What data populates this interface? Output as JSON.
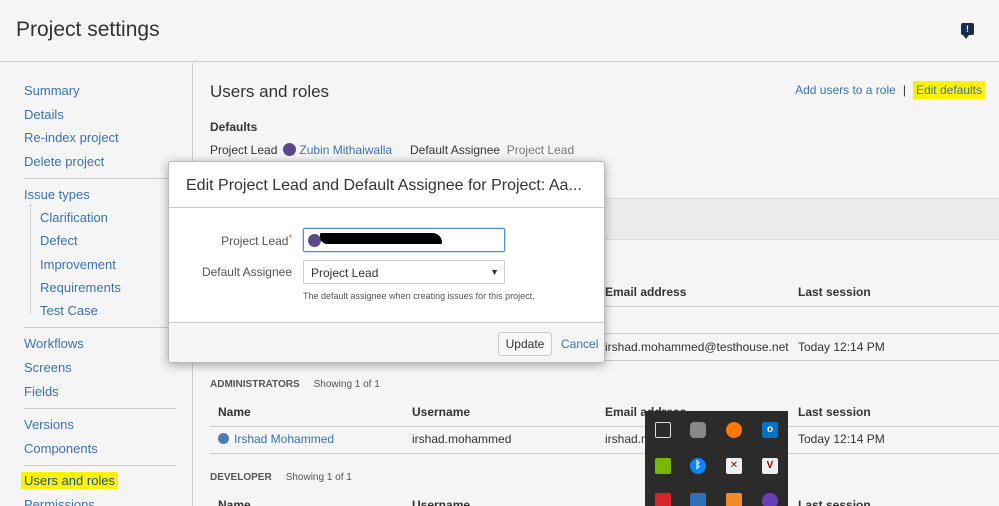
{
  "header": {
    "title": "Project settings"
  },
  "sidebar": {
    "group1": [
      "Summary",
      "Details",
      "Re-index project",
      "Delete project"
    ],
    "issue_types": {
      "label": "Issue types",
      "children": [
        "Clarification",
        "Defect",
        "Improvement",
        "Requirements",
        "Test Case"
      ]
    },
    "group3": [
      "Workflows",
      "Screens",
      "Fields"
    ],
    "group4": [
      "Versions",
      "Components"
    ],
    "group5": [
      "Users and roles",
      "Permissions"
    ]
  },
  "main": {
    "title": "Users and roles",
    "links": {
      "add_users": "Add users to a role",
      "separator": "|",
      "edit_defaults": "Edit defaults"
    },
    "defaults": {
      "heading": "Defaults",
      "project_lead_label": "Project Lead",
      "project_lead_value": "Zubin Mithaiwalla",
      "default_assignee_label": "Default Assignee",
      "default_assignee_value": "Project Lead"
    },
    "columns": {
      "name": "Name",
      "username": "Username",
      "email": "Email address",
      "last_session": "Last session"
    },
    "row_top": {
      "email": "irshad.mohammed@testhouse.net",
      "last_session": "Today 12:14 PM"
    },
    "administrators": {
      "heading": "Administrators",
      "count": "Showing 1 of 1",
      "rows": [
        {
          "name": "Irshad Mohammed",
          "username": "irshad.mohammed",
          "email": "irshad.m",
          "last_session": "Today 12:14 PM"
        }
      ]
    },
    "developer": {
      "heading": "Developer",
      "count": "Showing 1 of 1"
    }
  },
  "dialog": {
    "title": "Edit Project Lead and Default Assignee for Project: Aa...",
    "project_lead_label": "Project Lead",
    "required_mark": "*",
    "default_assignee_label": "Default Assignee",
    "default_assignee_selected": "Project Lead",
    "description": "The default assignee when creating issues for this project.",
    "update_label": "Update",
    "cancel_label": "Cancel"
  },
  "tray_icons": [
    "monitor-icon",
    "lock-icon",
    "avast-icon",
    "outlook-icon",
    "nvidia-icon",
    "bluetooth-icon",
    "shield-x-icon",
    "vpn-icon",
    "record-icon",
    "network-icon",
    "app-icon",
    "app-icon-2"
  ],
  "colors": {
    "link": "#3b73af",
    "highlight": "#fff200",
    "required": "#d04437"
  }
}
